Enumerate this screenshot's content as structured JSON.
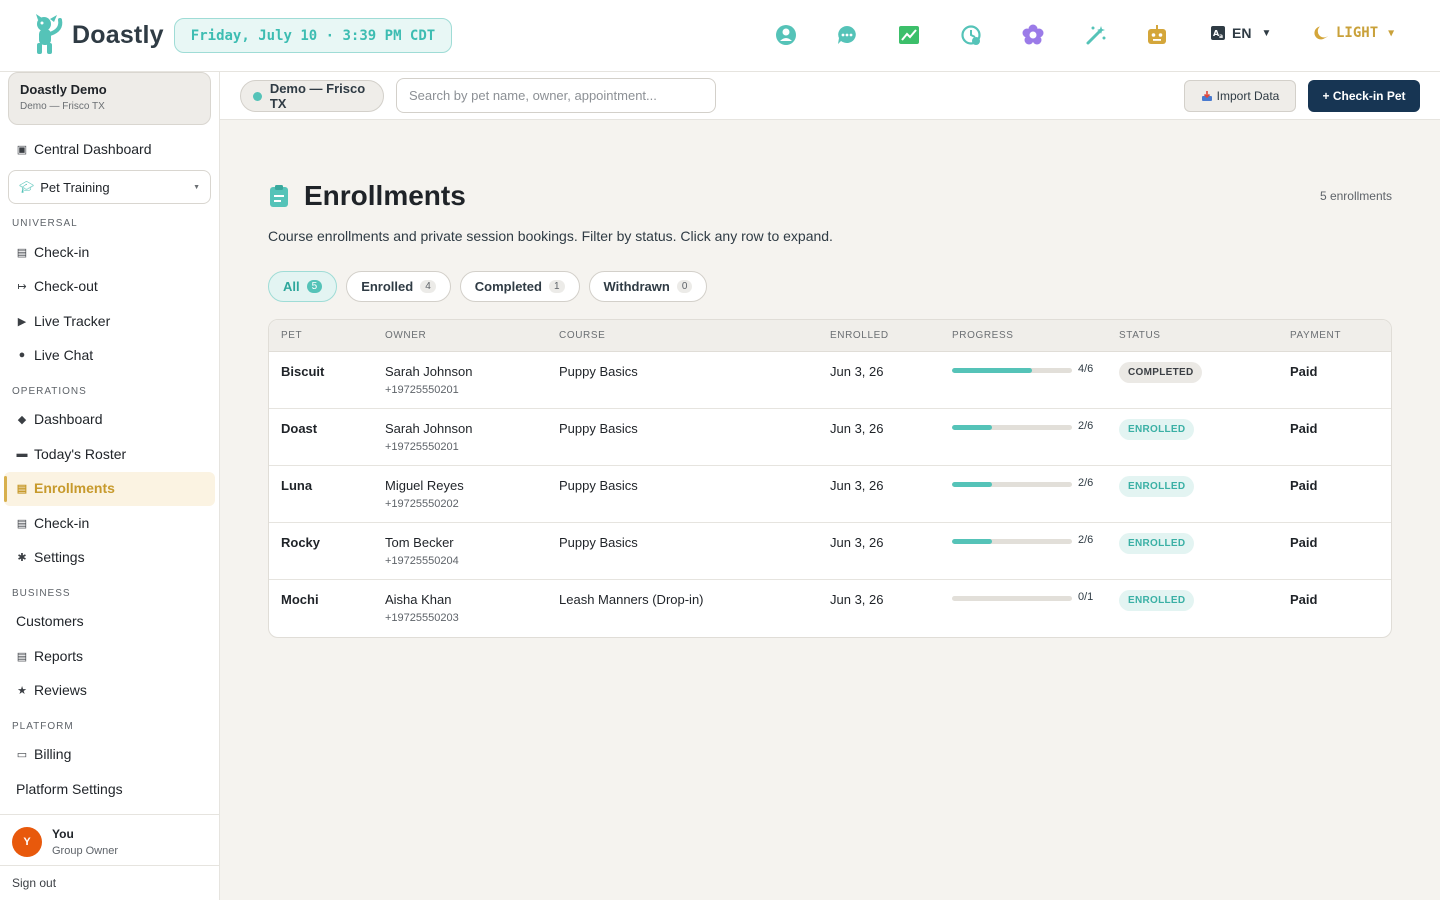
{
  "app": {
    "name": "Doastly"
  },
  "topbar": {
    "datetime": "Friday, July 10 · 3:39 PM CDT",
    "icons": [
      "support-icon",
      "chat-icon",
      "analytics-icon",
      "history-icon",
      "flower-icon",
      "magic-wand-icon",
      "robot-icon"
    ],
    "language": "EN",
    "theme": "LIGHT"
  },
  "sidebar": {
    "org": {
      "name": "Doastly Demo",
      "location": "Demo — Frisco TX"
    },
    "central_dashboard": "Central Dashboard",
    "module": "Pet Training",
    "sections": [
      {
        "label": "UNIVERSAL",
        "items": [
          "Check-in",
          "Check-out",
          "Live Tracker",
          "Live Chat"
        ]
      },
      {
        "label": "OPERATIONS",
        "items": [
          "Dashboard",
          "Today's Roster",
          "Enrollments",
          "Check-in",
          "Settings"
        ]
      },
      {
        "label": "BUSINESS",
        "items": [
          "Customers",
          "Reports",
          "Reviews"
        ]
      },
      {
        "label": "PLATFORM",
        "items": [
          "Billing",
          "Platform Settings"
        ]
      }
    ],
    "active_item": "Enrollments",
    "user": {
      "initial": "Y",
      "name": "You",
      "role": "Group Owner"
    },
    "sign_out": "Sign out"
  },
  "subheader": {
    "location": "Demo — Frisco TX",
    "search_placeholder": "Search by pet name, owner, appointment...",
    "import_label": "Import Data",
    "checkin_label": "+ Check-in Pet"
  },
  "page": {
    "title": "Enrollments",
    "count": "5 enrollments",
    "description": "Course enrollments and private session bookings. Filter by status. Click any row to expand.",
    "filters": [
      {
        "label": "All",
        "count": "5",
        "active": true
      },
      {
        "label": "Enrolled",
        "count": "4",
        "active": false
      },
      {
        "label": "Completed",
        "count": "1",
        "active": false
      },
      {
        "label": "Withdrawn",
        "count": "0",
        "active": false
      }
    ]
  },
  "table": {
    "columns": [
      "PET",
      "OWNER",
      "COURSE",
      "ENROLLED",
      "PROGRESS",
      "STATUS",
      "PAYMENT"
    ],
    "rows": [
      {
        "pet": "Biscuit",
        "owner": "Sarah Johnson",
        "phone": "+19725550201",
        "course": "Puppy Basics",
        "enrolled": "Jun 3, 26",
        "progress_label": "4/6",
        "progress": 0.667,
        "status": "COMPLETED",
        "payment": "Paid"
      },
      {
        "pet": "Doast",
        "owner": "Sarah Johnson",
        "phone": "+19725550201",
        "course": "Puppy Basics",
        "enrolled": "Jun 3, 26",
        "progress_label": "2/6",
        "progress": 0.333,
        "status": "ENROLLED",
        "payment": "Paid"
      },
      {
        "pet": "Luna",
        "owner": "Miguel Reyes",
        "phone": "+19725550202",
        "course": "Puppy Basics",
        "enrolled": "Jun 3, 26",
        "progress_label": "2/6",
        "progress": 0.333,
        "status": "ENROLLED",
        "payment": "Paid"
      },
      {
        "pet": "Rocky",
        "owner": "Tom Becker",
        "phone": "+19725550204",
        "course": "Puppy Basics",
        "enrolled": "Jun 3, 26",
        "progress_label": "2/6",
        "progress": 0.333,
        "status": "ENROLLED",
        "payment": "Paid"
      },
      {
        "pet": "Mochi",
        "owner": "Aisha Khan",
        "phone": "+19725550203",
        "course": "Leash Manners (Drop-in)",
        "enrolled": "Jun 3, 26",
        "progress_label": "0/1",
        "progress": 0,
        "status": "ENROLLED",
        "payment": "Paid"
      }
    ]
  },
  "colors": {
    "accent_teal": "#55c3b8",
    "active_gold": "#c79a2c",
    "primary_navy": "#173553",
    "avatar_orange": "#e8590c"
  }
}
